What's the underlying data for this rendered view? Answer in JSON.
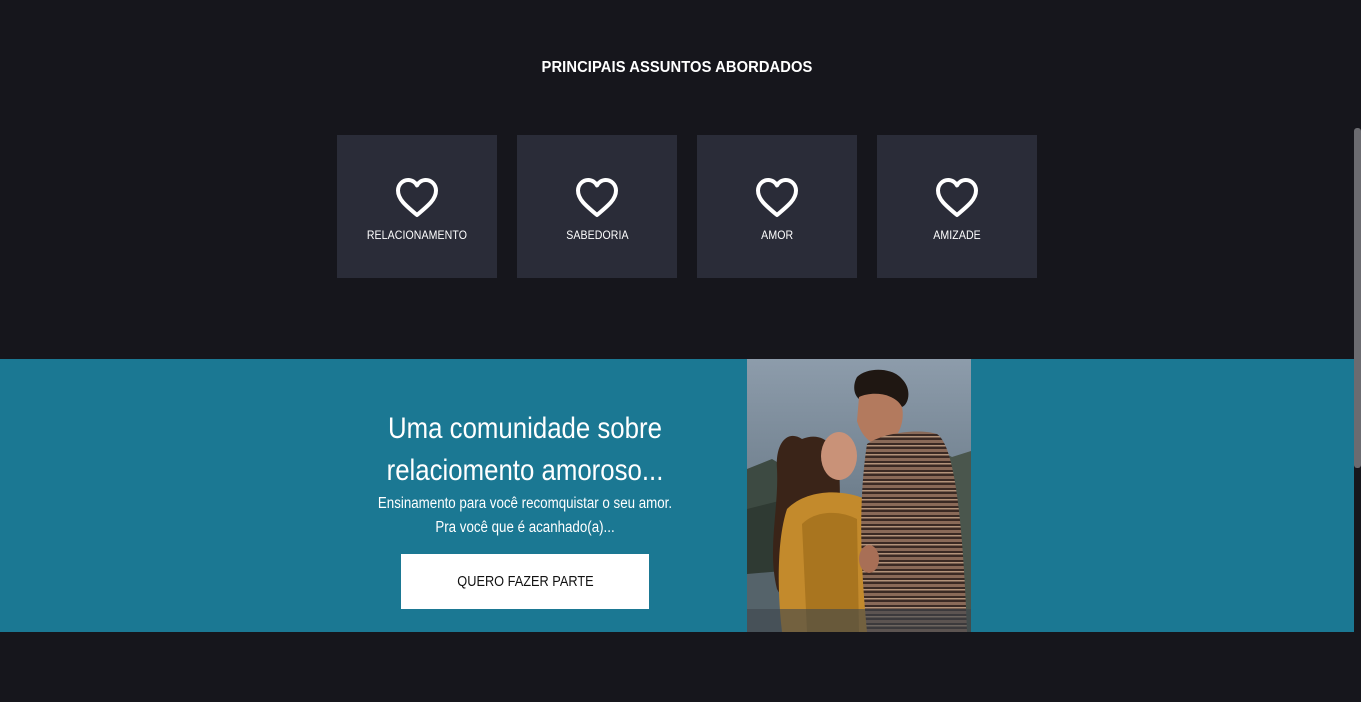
{
  "topics_section": {
    "title": "PRINCIPAIS ASSUNTOS ABORDADOS",
    "icon": "heart-icon",
    "cards": [
      {
        "label": "RELACIONAMENTO"
      },
      {
        "label": "SABEDORIA"
      },
      {
        "label": "AMOR"
      },
      {
        "label": "AMIZADE"
      }
    ]
  },
  "banner": {
    "headline_line1": "Uma comunidade sobre",
    "headline_line2": "relaciomento amoroso...",
    "subtitle_line1": "Ensinamento para você recomquistar o seu amor.",
    "subtitle_line2": "Pra você que é acanhado(a)...",
    "cta_label": "QUERO FAZER PARTE",
    "image_subject": "couple-embracing-photo"
  },
  "colors": {
    "page_background": "#16161c",
    "card_background": "#2a2c38",
    "banner_background": "#1b7893",
    "cta_background": "#ffffff"
  }
}
